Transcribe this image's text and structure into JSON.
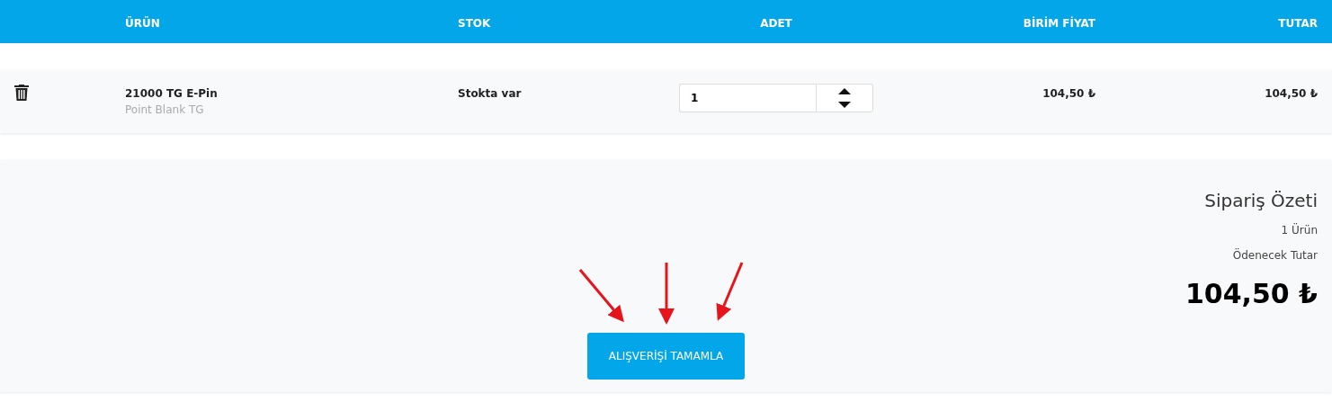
{
  "table": {
    "columns": [
      "ÜRÜN",
      "STOK",
      "ADET",
      "BİRİM FİYAT",
      "TUTAR"
    ],
    "rows": [
      {
        "name": "21000 TG E-Pin",
        "subtitle": "Point Blank TG",
        "stock": "Stokta var",
        "quantity": "1",
        "unit_price": "104,50 ₺",
        "total": "104,50 ₺"
      }
    ]
  },
  "summary": {
    "title": "Sipariş Özeti",
    "count": "1 Ürün",
    "amount_label": "Ödenecek Tutar",
    "amount": "104,50 ₺",
    "button": "ALIŞVERİŞİ TAMAMLA"
  }
}
